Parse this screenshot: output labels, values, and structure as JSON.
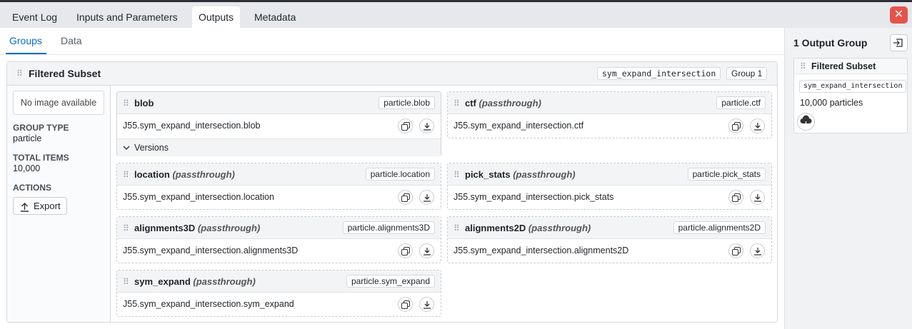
{
  "tabs": [
    {
      "label": "Event Log",
      "active": false
    },
    {
      "label": "Inputs and Parameters",
      "active": false
    },
    {
      "label": "Outputs",
      "active": true
    },
    {
      "label": "Metadata",
      "active": false
    }
  ],
  "subtabs": [
    {
      "label": "Groups",
      "active": true
    },
    {
      "label": "Data",
      "active": false
    }
  ],
  "group": {
    "title": "Filtered Subset",
    "name_chip": "sym_expand_intersection",
    "group_chip": "Group 1",
    "no_image": "No image available",
    "group_type_label": "GROUP TYPE",
    "group_type": "particle",
    "total_items_label": "TOTAL ITEMS",
    "total_items": "10,000",
    "actions_label": "ACTIONS",
    "export_label": "Export"
  },
  "slots": [
    {
      "name": "blob",
      "passthrough": "",
      "chip": "particle.blob",
      "path": "J55.sym_expand_intersection.blob",
      "versions": "Versions"
    },
    {
      "name": "ctf",
      "passthrough": "(passthrough)",
      "chip": "particle.ctf",
      "path": "J55.sym_expand_intersection.ctf"
    },
    {
      "name": "location",
      "passthrough": "(passthrough)",
      "chip": "particle.location",
      "path": "J55.sym_expand_intersection.location"
    },
    {
      "name": "pick_stats",
      "passthrough": "(passthrough)",
      "chip": "particle.pick_stats",
      "path": "J55.sym_expand_intersection.pick_stats"
    },
    {
      "name": "alignments3D",
      "passthrough": "(passthrough)",
      "chip": "particle.alignments3D",
      "path": "J55.sym_expand_intersection.alignments3D"
    },
    {
      "name": "alignments2D",
      "passthrough": "(passthrough)",
      "chip": "particle.alignments2D",
      "path": "J55.sym_expand_intersection.alignments2D"
    },
    {
      "name": "sym_expand",
      "passthrough": "(passthrough)",
      "chip": "particle.sym_expand",
      "path": "J55.sym_expand_intersection.sym_expand"
    }
  ],
  "right_panel": {
    "title": "1 Output Group",
    "card_title": "Filtered Subset",
    "card_chip": "sym_expand_intersection",
    "card_count": "10,000 particles"
  },
  "colors": {
    "accent": "#0b6bcb",
    "close": "#e5534b"
  },
  "icons": [
    "close-icon",
    "drag-handle-icon",
    "copy-icon",
    "download-icon",
    "upload-icon",
    "chevron-down-icon",
    "sidebar-collapse-icon",
    "cloud-download-icon"
  ]
}
